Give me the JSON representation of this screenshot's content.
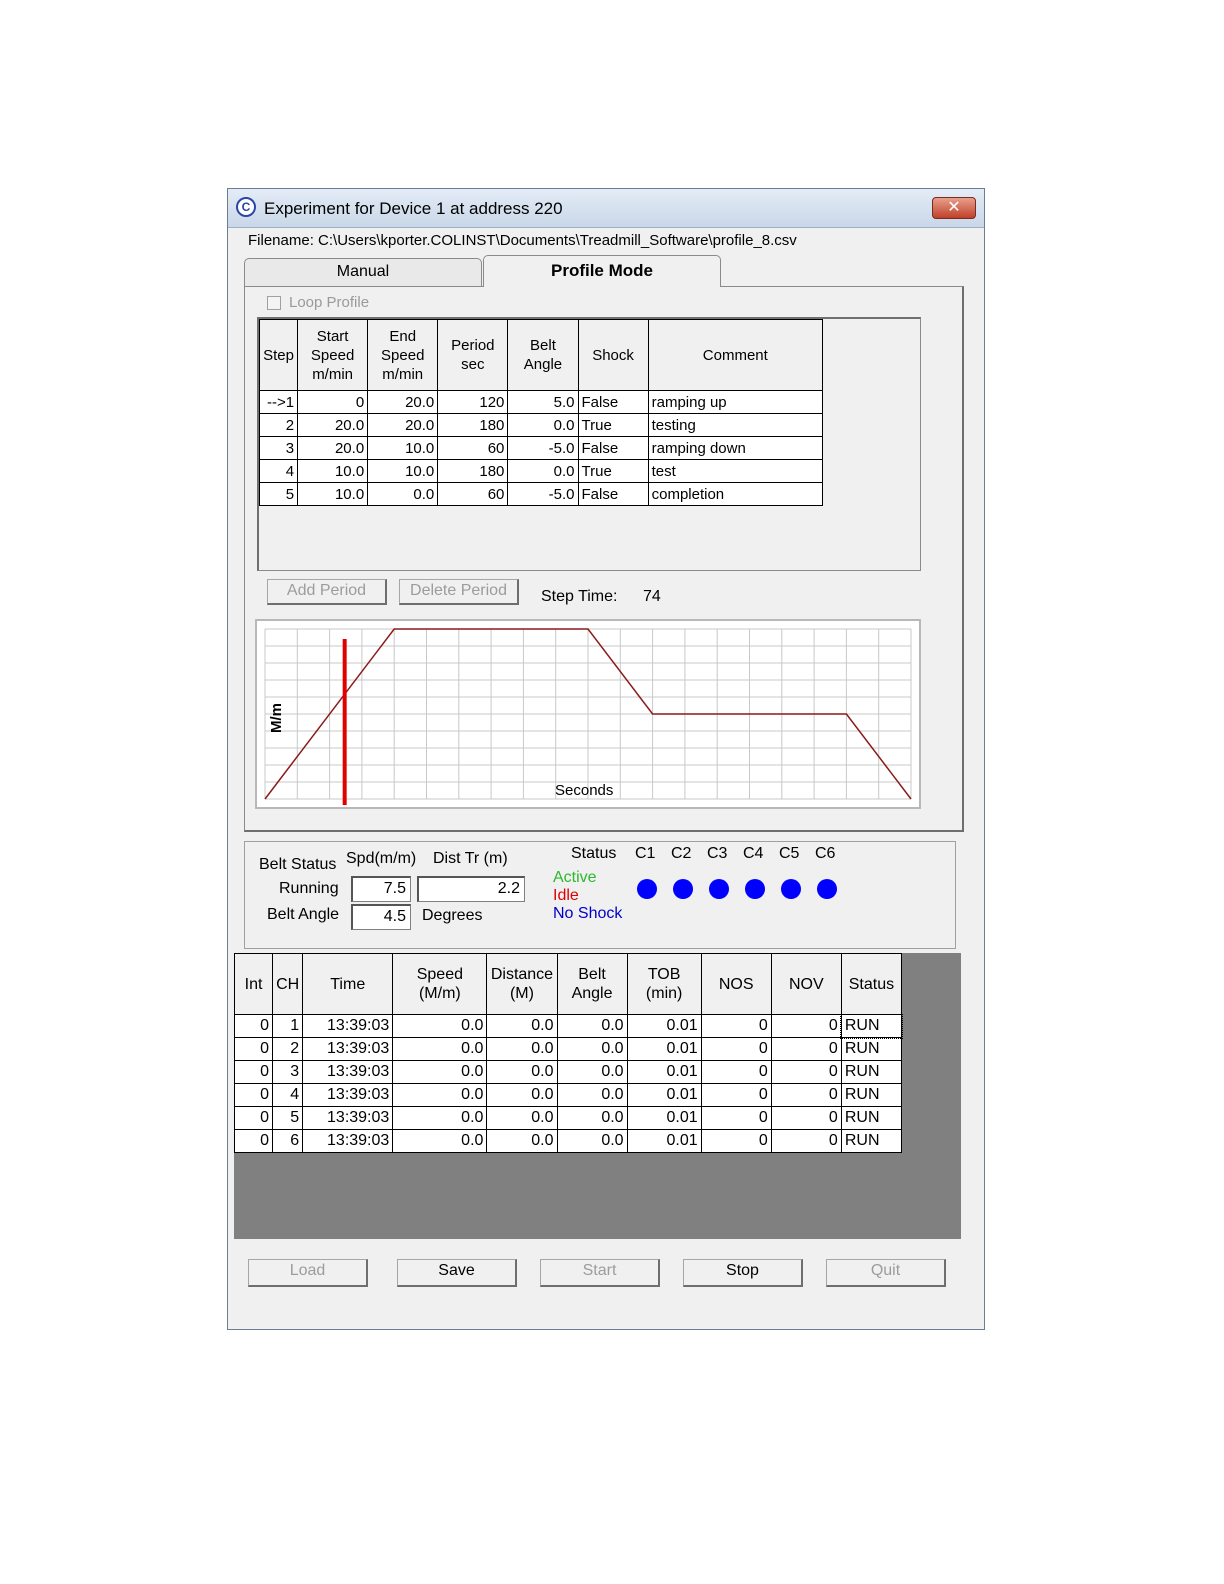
{
  "window": {
    "title": "Experiment for Device 1 at address 220",
    "close_glyph": "✕",
    "icon_glyph": "C"
  },
  "filename": "Filename: C:\\Users\\kporter.COLINST\\Documents\\Treadmill_Software\\profile_8.csv",
  "tabs": {
    "manual": "Manual",
    "profile": "Profile Mode"
  },
  "loop_profile": {
    "label": "Loop Profile",
    "checked": false
  },
  "profile_table": {
    "headers": [
      "Step",
      "Start\nSpeed\nm/min",
      "End\nSpeed\nm/min",
      "Period\nsec",
      "Belt\nAngle",
      "Shock",
      "Comment"
    ],
    "rows": [
      [
        "-->1",
        "0",
        "20.0",
        "120",
        "5.0",
        "False",
        "ramping up"
      ],
      [
        "2",
        "20.0",
        "20.0",
        "180",
        "0.0",
        "True",
        "testing"
      ],
      [
        "3",
        "20.0",
        "10.0",
        "60",
        "-5.0",
        "False",
        "ramping down"
      ],
      [
        "4",
        "10.0",
        "10.0",
        "180",
        "0.0",
        "True",
        "test"
      ],
      [
        "5",
        "10.0",
        "0.0",
        "60",
        "-5.0",
        "False",
        "completion"
      ]
    ]
  },
  "buttons_profile": {
    "add_period": "Add Period",
    "delete_period": "Delete Period"
  },
  "step_time": {
    "label": "Step Time:",
    "value": "74"
  },
  "chart_data": {
    "type": "line",
    "xlabel": "Seconds",
    "ylabel": "M/m",
    "x": [
      0,
      120,
      300,
      360,
      540,
      600
    ],
    "values": [
      0,
      20,
      20,
      10,
      10,
      0
    ],
    "xlim": [
      0,
      600
    ],
    "ylim": [
      0,
      20
    ],
    "grid": true,
    "marker_x": 74,
    "line_color": "#8b1a1a",
    "marker_color": "#e00000"
  },
  "belt_status": {
    "label": "Belt Status",
    "spd_header": "Spd(m/m)",
    "dist_header": "Dist Tr (m)",
    "running_label": "Running",
    "speed_value": "7.5",
    "distance_value": "2.2",
    "angle_label": "Belt Angle",
    "angle_value": "4.5",
    "angle_unit": "Degrees"
  },
  "status_legend": {
    "title": "Status",
    "active": "Active",
    "idle": "Idle",
    "no_shock": "No Shock",
    "active_color": "#2db82d",
    "idle_color": "#e00000",
    "no_shock_color": "#0000cc"
  },
  "channels": [
    "C1",
    "C2",
    "C3",
    "C4",
    "C5",
    "C6"
  ],
  "channel_color": "#0000ff",
  "data_table": {
    "headers": [
      "Int",
      "CH",
      "Time",
      "Speed\n(M/m)",
      "Distance\n(M)",
      "Belt\nAngle",
      "TOB\n(min)",
      "NOS",
      "NOV",
      "Status"
    ],
    "rows": [
      [
        "0",
        "1",
        "13:39:03",
        "0.0",
        "0.0",
        "0.0",
        "0.01",
        "0",
        "0",
        "RUN"
      ],
      [
        "0",
        "2",
        "13:39:03",
        "0.0",
        "0.0",
        "0.0",
        "0.01",
        "0",
        "0",
        "RUN"
      ],
      [
        "0",
        "3",
        "13:39:03",
        "0.0",
        "0.0",
        "0.0",
        "0.01",
        "0",
        "0",
        "RUN"
      ],
      [
        "0",
        "4",
        "13:39:03",
        "0.0",
        "0.0",
        "0.0",
        "0.01",
        "0",
        "0",
        "RUN"
      ],
      [
        "0",
        "5",
        "13:39:03",
        "0.0",
        "0.0",
        "0.0",
        "0.01",
        "0",
        "0",
        "RUN"
      ],
      [
        "0",
        "6",
        "13:39:03",
        "0.0",
        "0.0",
        "0.0",
        "0.01",
        "0",
        "0",
        "RUN"
      ]
    ]
  },
  "bottom_buttons": {
    "load": "Load",
    "save": "Save",
    "start": "Start",
    "stop": "Stop",
    "quit": "Quit"
  }
}
